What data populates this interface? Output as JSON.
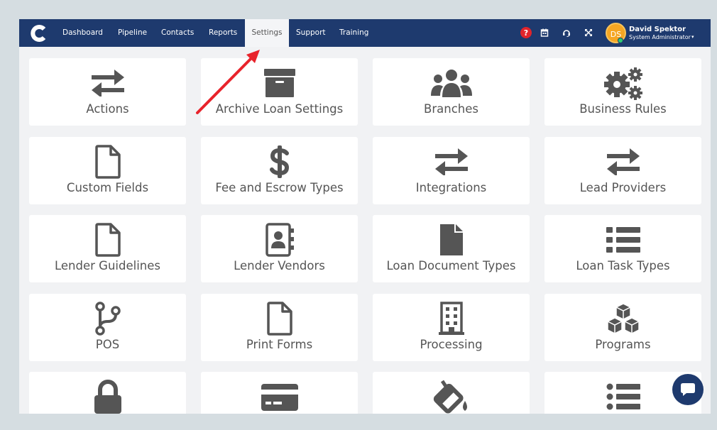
{
  "nav": {
    "items": [
      {
        "label": "Dashboard",
        "active": false
      },
      {
        "label": "Pipeline",
        "active": false
      },
      {
        "label": "Contacts",
        "active": false
      },
      {
        "label": "Reports",
        "active": false
      },
      {
        "label": "Settings",
        "active": true
      },
      {
        "label": "Support",
        "active": false
      },
      {
        "label": "Training",
        "active": false
      }
    ],
    "help_label": "?",
    "icons": [
      "help-icon",
      "calendar-icon",
      "headset-icon",
      "expand-icon"
    ],
    "user": {
      "initials": "DS",
      "name": "David Spektor",
      "role": "System Administrator",
      "caret": "▾"
    }
  },
  "tiles": [
    {
      "label": "Actions",
      "icon": "exchange-icon"
    },
    {
      "label": "Archive Loan Settings",
      "icon": "archive-icon"
    },
    {
      "label": "Branches",
      "icon": "users-icon"
    },
    {
      "label": "Business Rules",
      "icon": "cogs-icon"
    },
    {
      "label": "Custom Fields",
      "icon": "file-icon"
    },
    {
      "label": "Fee and Escrow Types",
      "icon": "dollar-icon"
    },
    {
      "label": "Integrations",
      "icon": "exchange-icon"
    },
    {
      "label": "Lead Providers",
      "icon": "exchange-icon"
    },
    {
      "label": "Lender Guidelines",
      "icon": "file-icon"
    },
    {
      "label": "Lender Vendors",
      "icon": "address-book-icon"
    },
    {
      "label": "Loan Document Types",
      "icon": "file-solid-icon"
    },
    {
      "label": "Loan Task Types",
      "icon": "list-icon"
    },
    {
      "label": "POS",
      "icon": "code-branch-icon"
    },
    {
      "label": "Print Forms",
      "icon": "file-icon"
    },
    {
      "label": "Processing",
      "icon": "building-icon"
    },
    {
      "label": "Programs",
      "icon": "cubes-icon"
    },
    {
      "label": "",
      "icon": "lock-icon"
    },
    {
      "label": "",
      "icon": "credit-card-icon"
    },
    {
      "label": "",
      "icon": "fill-drip-icon"
    },
    {
      "label": "",
      "icon": "list-ul-icon"
    }
  ],
  "colors": {
    "navbar": "#1e3a6e",
    "icon": "#555555",
    "annotation_arrow": "#e8232b",
    "help_badge": "#e0242b",
    "avatar": "#f5a623"
  }
}
